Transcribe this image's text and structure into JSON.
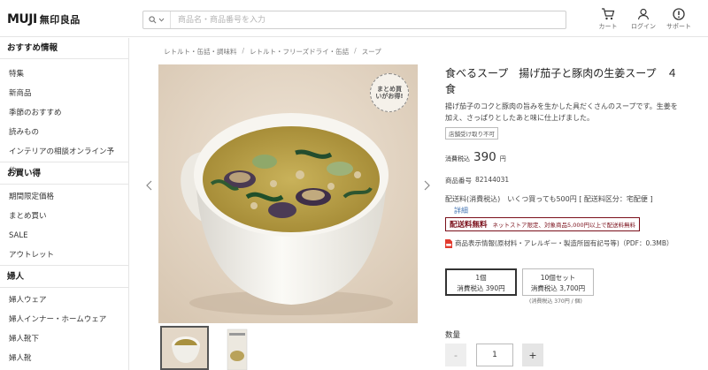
{
  "header": {
    "logo_brand": "MUJI",
    "logo_jp": "無印良品",
    "search_placeholder": "商品名・商品番号を入力",
    "icons": [
      {
        "name": "cart-icon",
        "label": "カート"
      },
      {
        "name": "login-icon",
        "label": "ログイン"
      },
      {
        "name": "support-icon",
        "label": "サポート"
      }
    ]
  },
  "sidebar": {
    "section1": "おすすめ情報",
    "items1": [
      "特集",
      "新商品",
      "季節のおすすめ",
      "読みもの",
      "インテリアの相談オンライン予約"
    ],
    "section2": "お買い得",
    "items2": [
      "期間限定価格",
      "まとめ買い",
      "SALE",
      "アウトレット"
    ],
    "section3": "婦人",
    "items3": [
      "婦人ウェア",
      "婦人インナー・ホームウェア",
      "婦人靴下",
      "婦人靴"
    ]
  },
  "breadcrumb": [
    "レトルト・缶詰・調味料",
    "レトルト・フリーズドライ・缶詰",
    "スープ"
  ],
  "product": {
    "badge_image": "まとめ買いがお得!",
    "title": "食べるスープ　揚げ茄子と豚肉の生姜スープ　４食",
    "description": "揚げ茄子のコクと豚肉の旨みを生かした具だくさんのスープです。生姜を加え、さっぱりとしたあと味に仕上げました。",
    "store_pickup_badge": "店舗受け取り不可",
    "price_tax_label": "消費税込",
    "price": "390",
    "price_unit": "円",
    "code_label": "商品番号",
    "code": "82144031",
    "shipping": "配送料(消費税込)　いくつ買っても500円 [ 配送料区分：宅配便 ]",
    "shipping_link": "詳細",
    "free_shipping": "配送料無料",
    "free_shipping_note": "ネットストア限定、対象商品5,000円以上で配送料無料",
    "pdf_label": "商品表示情報(原材料・アレルギー・製造所固有記号等)（PDF：0.3MB）",
    "options": [
      {
        "line1": "1個",
        "line2": "消費税込 390円"
      },
      {
        "line1": "10個セット",
        "line2": "消費税込 3,700円"
      }
    ],
    "option_note": "(消費税込 370円 / 個)",
    "qty_label": "数量",
    "qty_value": "1",
    "qty_minus": "-",
    "qty_plus": "+"
  },
  "colors": {
    "accent_red": "#7a0f1a",
    "link_blue": "#4a79b5"
  }
}
